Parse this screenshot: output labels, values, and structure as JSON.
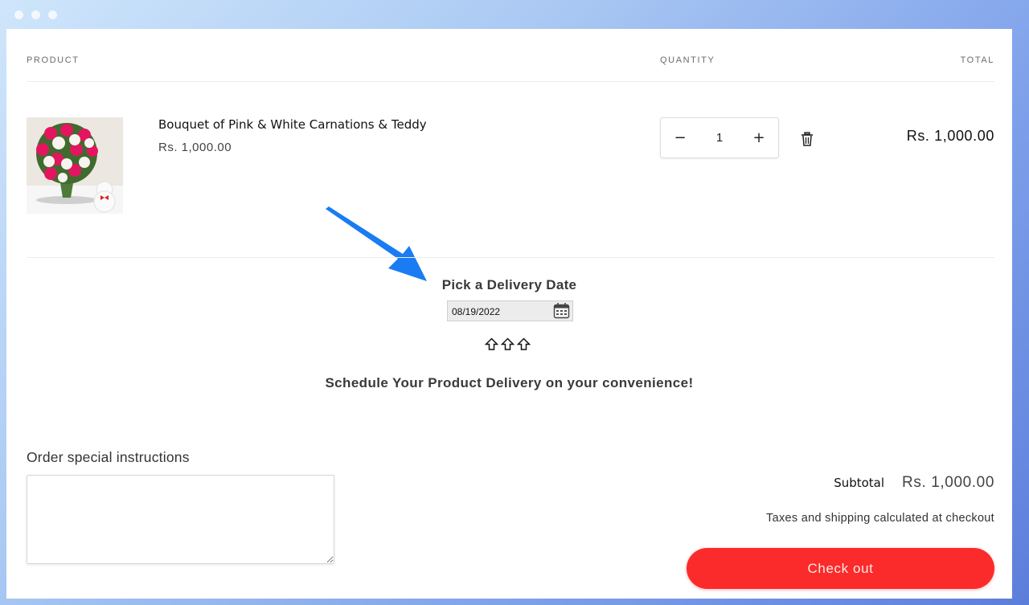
{
  "window": {
    "controls": [
      "dot",
      "dot",
      "dot"
    ]
  },
  "cart": {
    "headers": {
      "product": "PRODUCT",
      "quantity": "QUANTITY",
      "total": "TOTAL"
    },
    "items": [
      {
        "name": "Bouquet of Pink & White Carnations & Teddy",
        "price": "Rs. 1,000.00",
        "quantity": "1",
        "line_total": "Rs. 1,000.00",
        "image_alt": "Bouquet of pink and white carnations with teddy bear",
        "decrement_label": "−",
        "increment_label": "+",
        "remove_icon": "trash-icon"
      }
    ]
  },
  "delivery": {
    "title": "Pick a Delivery Date",
    "date_value": "08/19/2022",
    "calendar_icon": "calendar-icon",
    "arrow_icons": [
      "up-arrow-icon",
      "up-arrow-icon",
      "up-arrow-icon"
    ],
    "tagline": "Schedule Your Product Delivery on your convenience!",
    "annotation_arrow_color": "#1a7cf2"
  },
  "instructions": {
    "label": "Order special instructions",
    "value": "",
    "placeholder": ""
  },
  "summary": {
    "subtotal_label": "Subtotal",
    "subtotal_value": "Rs. 1,000.00",
    "tax_note": "Taxes and shipping calculated at checkout",
    "checkout_label": "Check out",
    "checkout_color": "#fb2b2b"
  }
}
